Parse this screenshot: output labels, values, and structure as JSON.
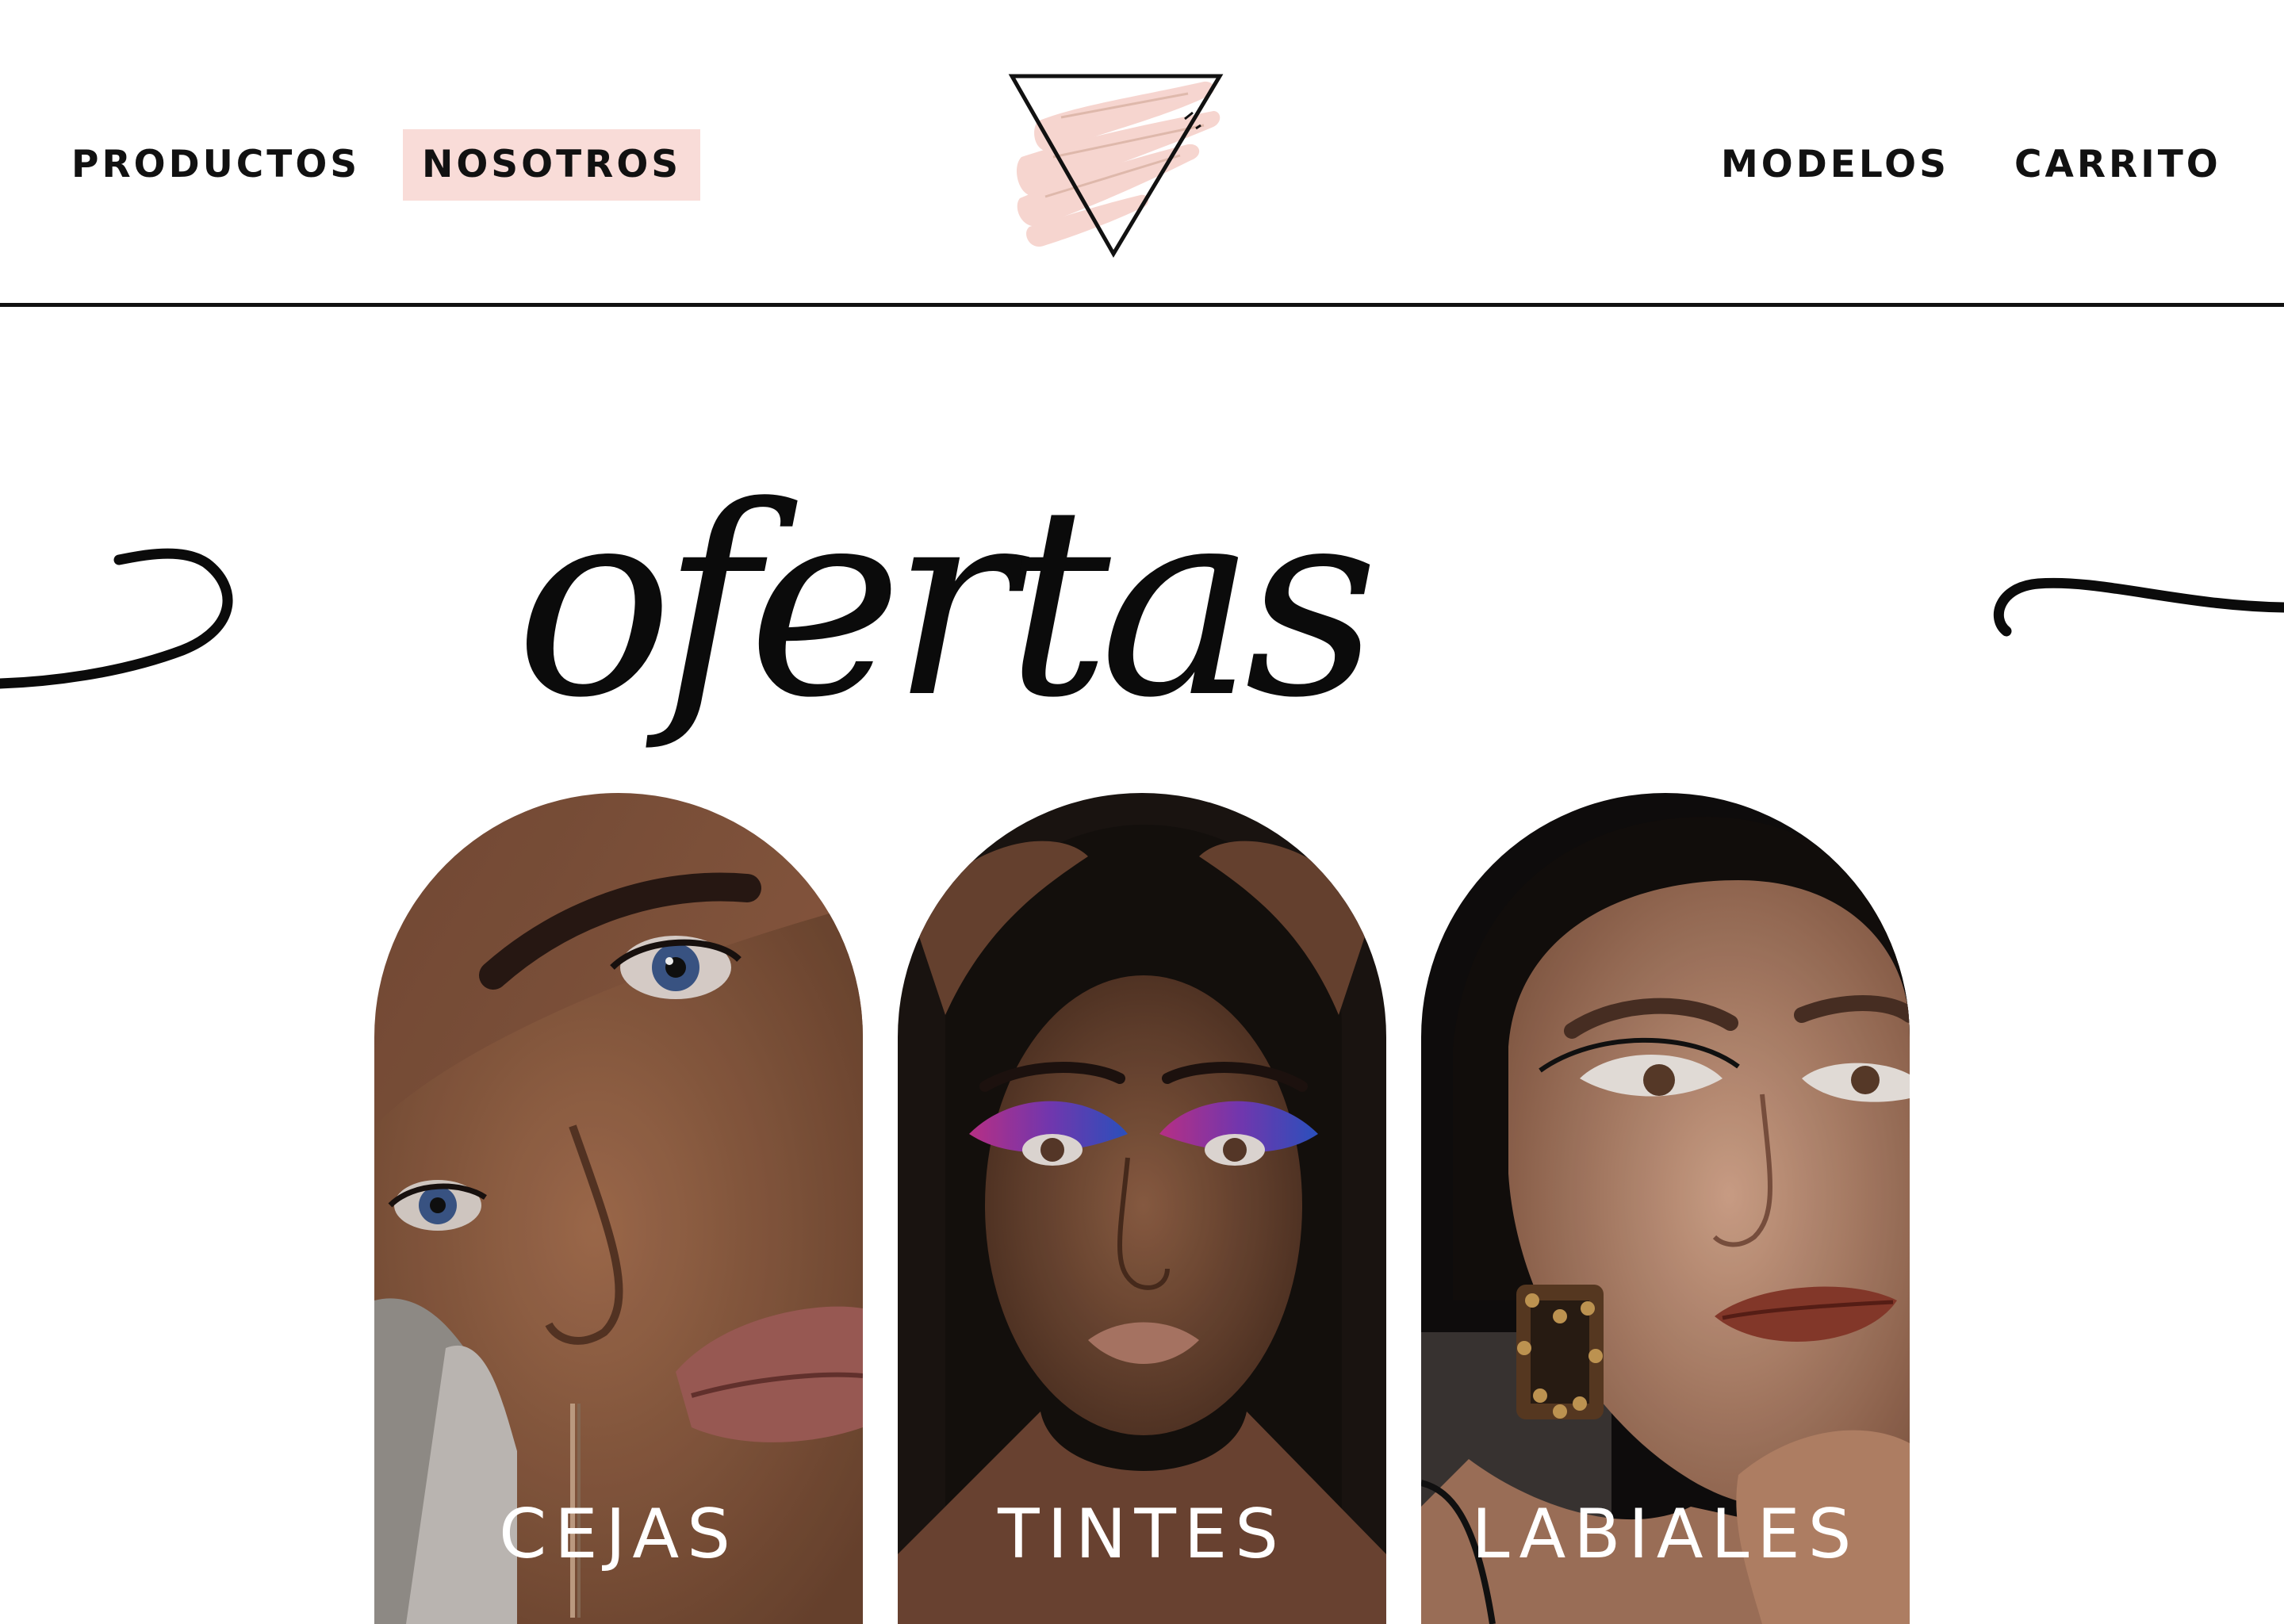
{
  "nav": {
    "left": [
      {
        "label": "PRODUCTOS"
      },
      {
        "label": "NOSOTROS",
        "active": true
      }
    ],
    "right": [
      {
        "label": "MODELOS"
      },
      {
        "label": "CARRITO"
      }
    ]
  },
  "hero": {
    "title": "ofertas"
  },
  "categories": [
    {
      "label": "CEJAS"
    },
    {
      "label": "TINTES"
    },
    {
      "label": "LABIALES"
    }
  ],
  "colors": {
    "accent_pink": "#f9dcd8",
    "text": "#111111",
    "background": "#ffffff"
  },
  "icons": {
    "logo": "triangle-brushstroke-logo"
  }
}
